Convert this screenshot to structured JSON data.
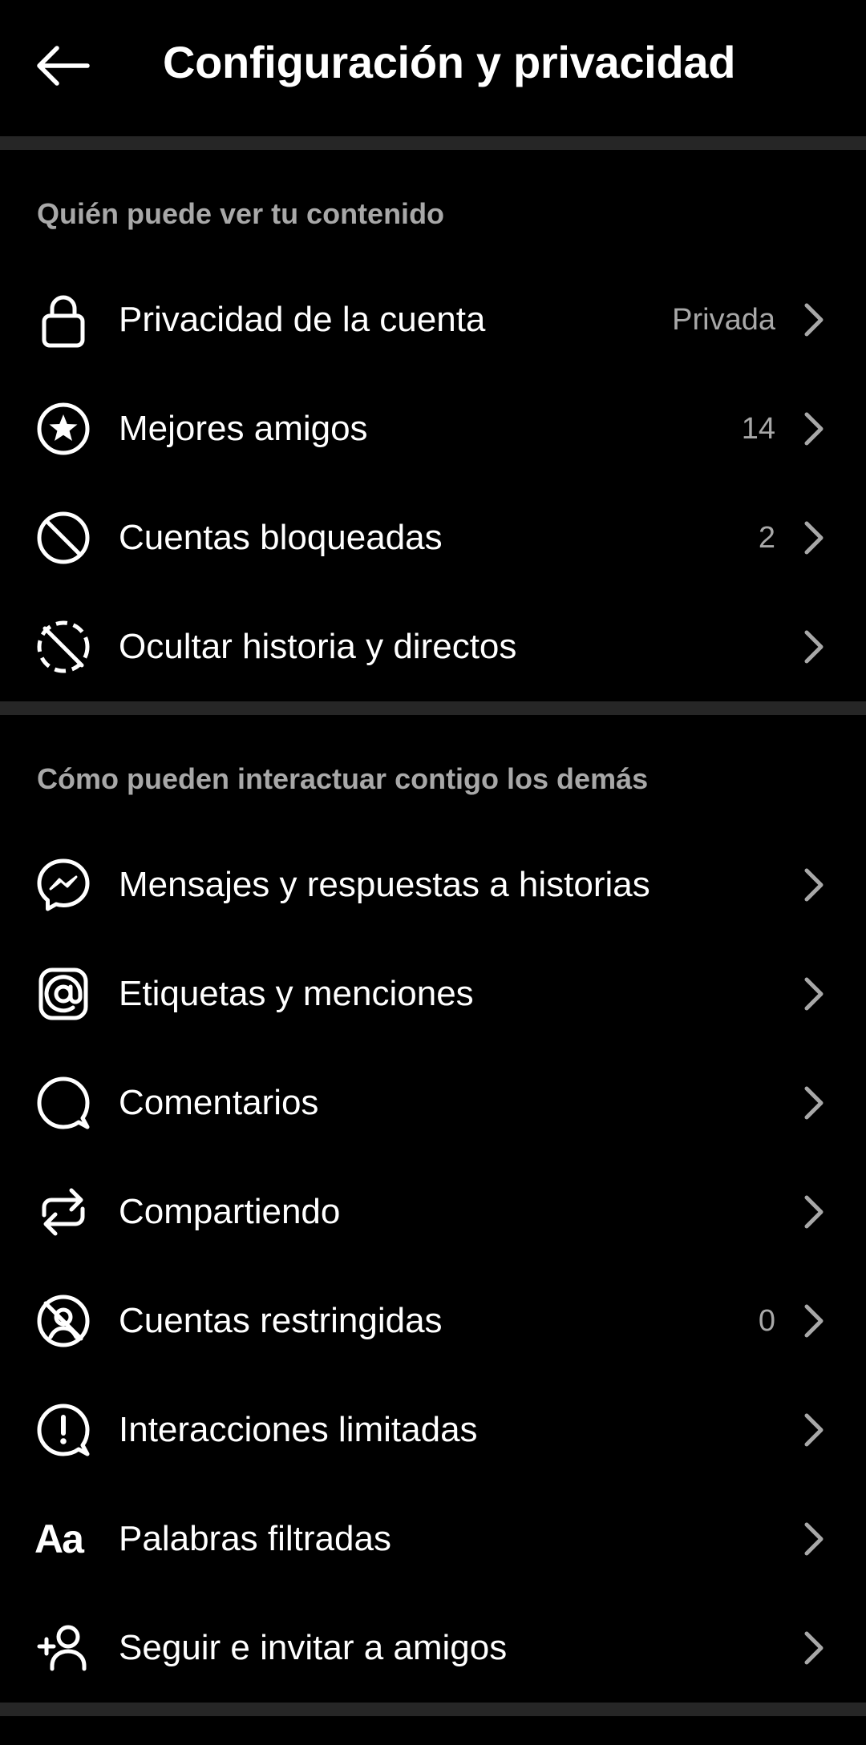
{
  "header": {
    "title": "Configuración y privacidad",
    "back_icon": "arrow-left-icon"
  },
  "sections": [
    {
      "title": "Quién puede ver tu contenido",
      "items": [
        {
          "label": "Privacidad de la cuenta",
          "value": "Privada",
          "icon": "lock-icon"
        },
        {
          "label": "Mejores amigos",
          "value": "14",
          "icon": "star-circle-icon"
        },
        {
          "label": "Cuentas bloqueadas",
          "value": "2",
          "icon": "blocked-icon"
        },
        {
          "label": "Ocultar historia y directos",
          "value": "",
          "icon": "hide-story-icon"
        }
      ]
    },
    {
      "title": "Cómo pueden interactuar contigo los demás",
      "items": [
        {
          "label": "Mensajes y respuestas a historias",
          "value": "",
          "icon": "messenger-icon"
        },
        {
          "label": "Etiquetas y menciones",
          "value": "",
          "icon": "at-sign-icon"
        },
        {
          "label": "Comentarios",
          "value": "",
          "icon": "comment-icon"
        },
        {
          "label": "Compartiendo",
          "value": "",
          "icon": "share-arrows-icon"
        },
        {
          "label": "Cuentas restringidas",
          "value": "0",
          "icon": "restricted-icon"
        },
        {
          "label": "Interacciones limitadas",
          "value": "",
          "icon": "limited-interactions-icon"
        },
        {
          "label": "Palabras filtradas",
          "value": "",
          "icon": "text-aa-icon",
          "icon_text": "Aa"
        },
        {
          "label": "Seguir e invitar a amigos",
          "value": "",
          "icon": "add-person-icon"
        }
      ]
    }
  ],
  "colors": {
    "background": "#000000",
    "divider": "#262626",
    "primary_text": "#ffffff",
    "secondary_text": "#a8a8a8"
  }
}
